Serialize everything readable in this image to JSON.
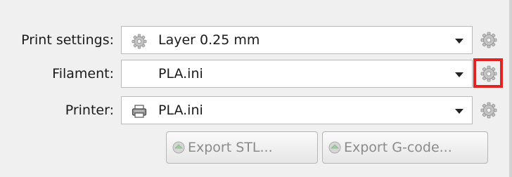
{
  "print_settings": {
    "label": "Print settings:",
    "value": "Layer 0.25 mm",
    "icon": "gear-icon"
  },
  "filament": {
    "label": "Filament:",
    "value": "PLA.ini",
    "icon": "none"
  },
  "printer": {
    "label": "Printer:",
    "value": "PLA.ini",
    "icon": "printer-icon"
  },
  "buttons": {
    "export_stl": "Export STL...",
    "export_gcode": "Export G-code..."
  },
  "colors": {
    "highlight": "#e32222",
    "disabled_text": "#8a8a8a"
  }
}
